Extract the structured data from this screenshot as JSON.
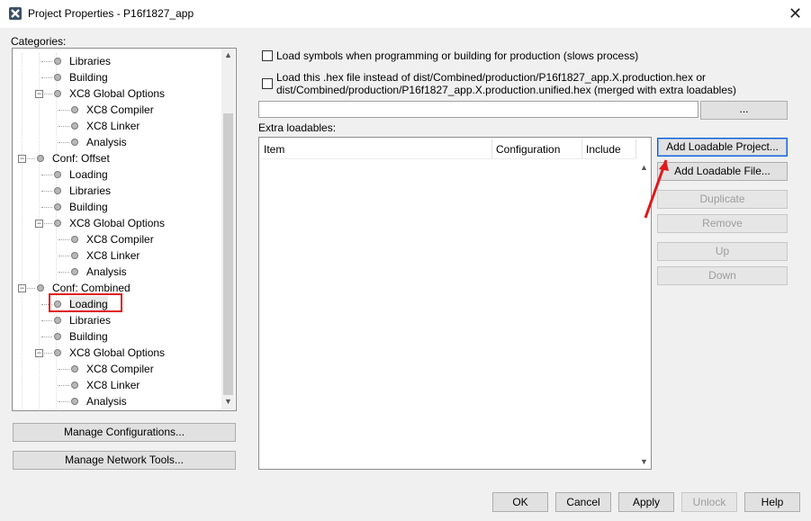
{
  "window": {
    "title": "Project Properties - P16f1827_app",
    "close_glyph": "✕"
  },
  "categories_label": "Categories:",
  "tree": {
    "items": [
      {
        "label": "Libraries",
        "depth": 2,
        "toggle": ""
      },
      {
        "label": "Building",
        "depth": 2,
        "toggle": ""
      },
      {
        "label": "XC8 Global Options",
        "depth": 2,
        "toggle": "−"
      },
      {
        "label": "XC8 Compiler",
        "depth": 3,
        "toggle": ""
      },
      {
        "label": "XC8 Linker",
        "depth": 3,
        "toggle": ""
      },
      {
        "label": "Analysis",
        "depth": 3,
        "toggle": ""
      },
      {
        "label": "Conf: Offset",
        "depth": 1,
        "toggle": "−"
      },
      {
        "label": "Loading",
        "depth": 2,
        "toggle": ""
      },
      {
        "label": "Libraries",
        "depth": 2,
        "toggle": ""
      },
      {
        "label": "Building",
        "depth": 2,
        "toggle": ""
      },
      {
        "label": "XC8 Global Options",
        "depth": 2,
        "toggle": "−"
      },
      {
        "label": "XC8 Compiler",
        "depth": 3,
        "toggle": ""
      },
      {
        "label": "XC8 Linker",
        "depth": 3,
        "toggle": ""
      },
      {
        "label": "Analysis",
        "depth": 3,
        "toggle": ""
      },
      {
        "label": "Conf: Combined",
        "depth": 1,
        "toggle": "−"
      },
      {
        "label": "Loading",
        "depth": 2,
        "toggle": "",
        "selected": true
      },
      {
        "label": "Libraries",
        "depth": 2,
        "toggle": ""
      },
      {
        "label": "Building",
        "depth": 2,
        "toggle": ""
      },
      {
        "label": "XC8 Global Options",
        "depth": 2,
        "toggle": "−"
      },
      {
        "label": "XC8 Compiler",
        "depth": 3,
        "toggle": ""
      },
      {
        "label": "XC8 Linker",
        "depth": 3,
        "toggle": ""
      },
      {
        "label": "Analysis",
        "depth": 3,
        "toggle": ""
      }
    ]
  },
  "left_buttons": {
    "manage_configs": "Manage Configurations...",
    "manage_network": "Manage Network Tools..."
  },
  "options": {
    "load_symbols": "Load symbols when programming or building for production (slows process)",
    "load_hex_line1": "Load this .hex file instead of dist/Combined/production/P16f1827_app.X.production.hex or",
    "load_hex_line2": "dist/Combined/production/P16f1827_app.X.production.unified.hex (merged with extra loadables)",
    "hex_path_value": "",
    "browse_label": "..."
  },
  "extra_loadables": {
    "label": "Extra loadables:",
    "columns": [
      "Item",
      "Configuration",
      "Include"
    ]
  },
  "side_buttons": {
    "add_project": "Add Loadable Project...",
    "add_file": "Add Loadable File...",
    "duplicate": "Duplicate",
    "remove": "Remove",
    "up": "Up",
    "down": "Down"
  },
  "footer": {
    "ok": "OK",
    "cancel": "Cancel",
    "apply": "Apply",
    "unlock": "Unlock",
    "help": "Help"
  },
  "annotation": {
    "color": "#e0191b"
  }
}
